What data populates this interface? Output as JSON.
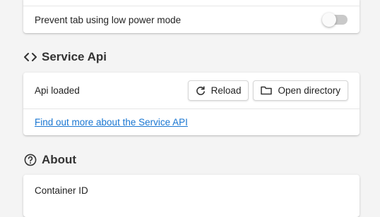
{
  "performance": {
    "prevent_tab_label": "Prevent tab using low power mode",
    "prevent_tab_enabled": false
  },
  "service_api": {
    "heading": "Service Api",
    "heading_icon": "code-icon",
    "status_text": "Api loaded",
    "reload_label": "Reload",
    "reload_icon": "reload-icon",
    "open_directory_label": "Open directory",
    "open_directory_icon": "folder-icon",
    "more_info_link": "Find out more about the Service API"
  },
  "about": {
    "heading": "About",
    "heading_icon": "help-circle-icon",
    "container_id_label": "Container ID"
  },
  "colors": {
    "link": "#1976d2",
    "toggle_track_off": "#c9c9c9",
    "background": "#f4f4f4"
  }
}
